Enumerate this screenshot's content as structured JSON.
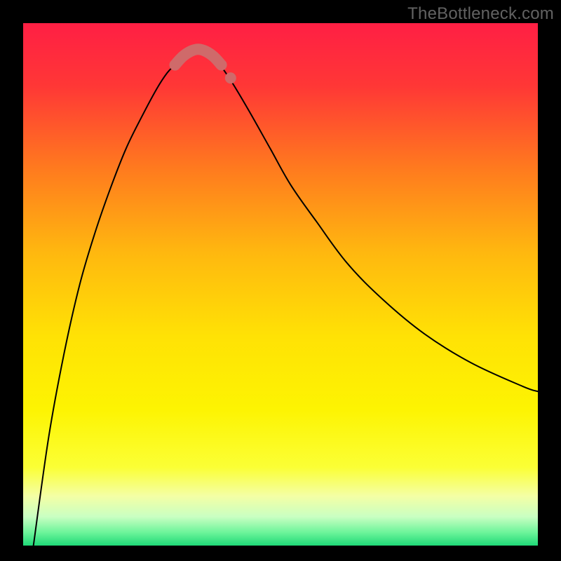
{
  "watermark": "TheBottleneck.com",
  "chart_data": {
    "type": "line",
    "title": "",
    "xlabel": "",
    "ylabel": "",
    "xlim": [
      0,
      100
    ],
    "ylim": [
      0,
      100
    ],
    "grid": false,
    "legend": false,
    "background_gradient": {
      "stops": [
        {
          "offset": 0.0,
          "color": "#ff1f44"
        },
        {
          "offset": 0.12,
          "color": "#ff3736"
        },
        {
          "offset": 0.28,
          "color": "#ff7b1e"
        },
        {
          "offset": 0.44,
          "color": "#ffb80f"
        },
        {
          "offset": 0.6,
          "color": "#ffe205"
        },
        {
          "offset": 0.74,
          "color": "#fdf402"
        },
        {
          "offset": 0.85,
          "color": "#fbff35"
        },
        {
          "offset": 0.905,
          "color": "#f4ffa5"
        },
        {
          "offset": 0.945,
          "color": "#c9ffc2"
        },
        {
          "offset": 0.975,
          "color": "#6cf49a"
        },
        {
          "offset": 1.0,
          "color": "#1fd977"
        }
      ]
    },
    "series": [
      {
        "name": "bottleneck-curve",
        "stroke": "#000000",
        "stroke_width": 2,
        "x": [
          2,
          5,
          8,
          11,
          14,
          17,
          20,
          23,
          26,
          28,
          29.5,
          31,
          32.5,
          34,
          35.5,
          37,
          39,
          41,
          44,
          48,
          52,
          57,
          63,
          70,
          78,
          87,
          97,
          100
        ],
        "y": [
          0,
          21,
          37,
          50,
          60,
          68.5,
          76,
          82,
          87.5,
          90.5,
          92,
          93.5,
          94.5,
          95,
          94.5,
          93.5,
          91,
          88,
          83,
          76,
          69,
          62,
          54,
          47,
          40.5,
          35,
          30.5,
          29.5
        ]
      }
    ],
    "highlight_band": {
      "name": "optimal-range",
      "color": "#cf6a6a",
      "stroke_width": 16,
      "linecap": "round",
      "x": [
        29.5,
        31,
        32.5,
        34,
        35.5,
        37,
        38.5
      ],
      "y": [
        92,
        93.6,
        94.6,
        95.0,
        94.6,
        93.6,
        92
      ]
    },
    "highlight_dot": {
      "name": "marker-dot",
      "color": "#cf6a6a",
      "radius": 8,
      "x": 40.3,
      "y": 89.5
    }
  }
}
